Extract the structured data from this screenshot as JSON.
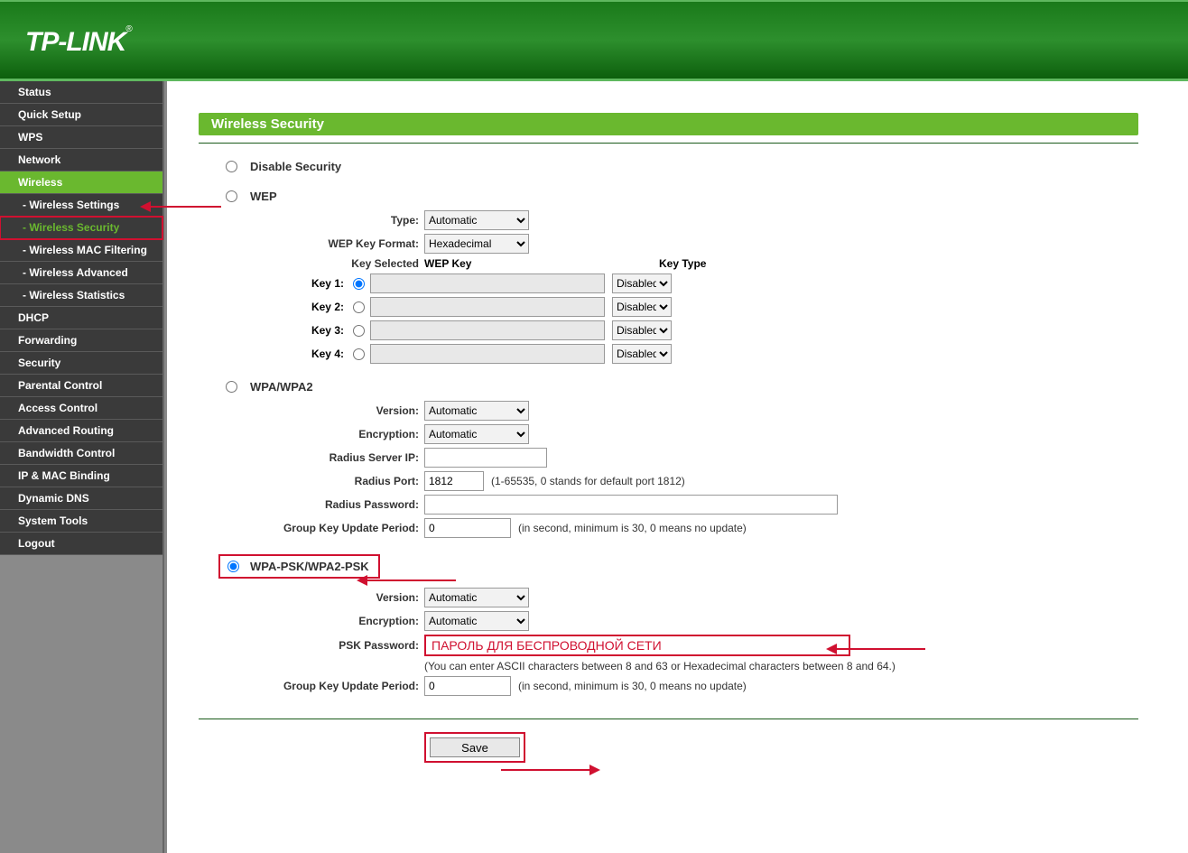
{
  "brand": "TP-LINK",
  "sidebar": {
    "items": [
      {
        "label": "Status"
      },
      {
        "label": "Quick Setup"
      },
      {
        "label": "WPS"
      },
      {
        "label": "Network"
      },
      {
        "label": "Wireless",
        "active": true
      },
      {
        "label": "- Wireless Settings",
        "sub": true
      },
      {
        "label": "- Wireless Security",
        "sub": true,
        "selected": true
      },
      {
        "label": "- Wireless MAC Filtering",
        "sub": true
      },
      {
        "label": "- Wireless Advanced",
        "sub": true
      },
      {
        "label": "- Wireless Statistics",
        "sub": true
      },
      {
        "label": "DHCP"
      },
      {
        "label": "Forwarding"
      },
      {
        "label": "Security"
      },
      {
        "label": "Parental Control"
      },
      {
        "label": "Access Control"
      },
      {
        "label": "Advanced Routing"
      },
      {
        "label": "Bandwidth Control"
      },
      {
        "label": "IP & MAC Binding"
      },
      {
        "label": "Dynamic DNS"
      },
      {
        "label": "System Tools"
      },
      {
        "label": "Logout"
      }
    ]
  },
  "page": {
    "title": "Wireless Security",
    "disable_label": "Disable Security",
    "wep": {
      "label": "WEP",
      "type_label": "Type:",
      "type_value": "Automatic",
      "format_label": "WEP Key Format:",
      "format_value": "Hexadecimal",
      "key_selected_label": "Key Selected",
      "wep_key_header": "WEP Key",
      "key_type_header": "Key Type",
      "keys": [
        {
          "label": "Key 1:",
          "value": "",
          "type": "Disabled"
        },
        {
          "label": "Key 2:",
          "value": "",
          "type": "Disabled"
        },
        {
          "label": "Key 3:",
          "value": "",
          "type": "Disabled"
        },
        {
          "label": "Key 4:",
          "value": "",
          "type": "Disabled"
        }
      ]
    },
    "wpa": {
      "label": "WPA/WPA2",
      "version_label": "Version:",
      "version_value": "Automatic",
      "encryption_label": "Encryption:",
      "encryption_value": "Automatic",
      "radius_ip_label": "Radius Server IP:",
      "radius_ip_value": "",
      "radius_port_label": "Radius Port:",
      "radius_port_value": "1812",
      "radius_port_hint": "(1-65535, 0 stands for default port 1812)",
      "radius_pw_label": "Radius Password:",
      "radius_pw_value": "",
      "gkup_label": "Group Key Update Period:",
      "gkup_value": "0",
      "gkup_hint": "(in second, minimum is 30, 0 means no update)"
    },
    "wpapsk": {
      "label": "WPA-PSK/WPA2-PSK",
      "version_label": "Version:",
      "version_value": "Automatic",
      "encryption_label": "Encryption:",
      "encryption_value": "Automatic",
      "psk_label": "PSK Password:",
      "psk_value": "ПАРОЛЬ ДЛЯ БЕСПРОВОДНОЙ СЕТИ",
      "psk_hint": "(You can enter ASCII characters between 8 and 63 or Hexadecimal characters between 8 and 64.)",
      "gkup_label": "Group Key Update Period:",
      "gkup_value": "0",
      "gkup_hint": "(in second, minimum is 30, 0 means no update)"
    },
    "save_label": "Save"
  }
}
